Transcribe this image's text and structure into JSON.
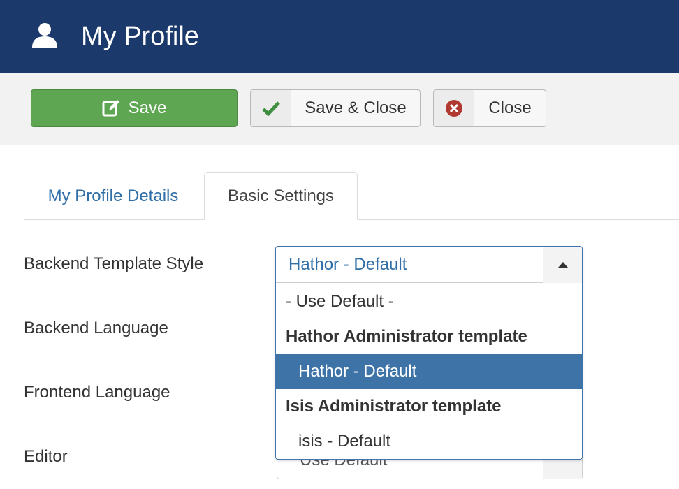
{
  "header": {
    "title": "My Profile",
    "icon": "user-icon"
  },
  "toolbar": {
    "save_label": "Save",
    "save_close_label": "Save & Close",
    "close_label": "Close",
    "colors": {
      "save": "#5fa653",
      "check": "#3f8e3f",
      "close_icon": "#b03a32"
    }
  },
  "tabs": [
    {
      "label": "My Profile Details",
      "active": false
    },
    {
      "label": "Basic Settings",
      "active": true
    }
  ],
  "form": {
    "labels": {
      "backend_template_style": "Backend Template Style",
      "backend_language": "Backend Language",
      "frontend_language": "Frontend Language",
      "editor": "Editor"
    },
    "template_select": {
      "value": "Hathor - Default",
      "options": [
        {
          "label": "- Use Default -",
          "type": "plain"
        },
        {
          "label": "Hathor Administrator template",
          "type": "group"
        },
        {
          "label": "Hathor - Default",
          "type": "item",
          "selected": true
        },
        {
          "label": "Isis Administrator template",
          "type": "group"
        },
        {
          "label": "isis - Default",
          "type": "item"
        }
      ]
    },
    "editor_value_partial": "Use Default"
  }
}
